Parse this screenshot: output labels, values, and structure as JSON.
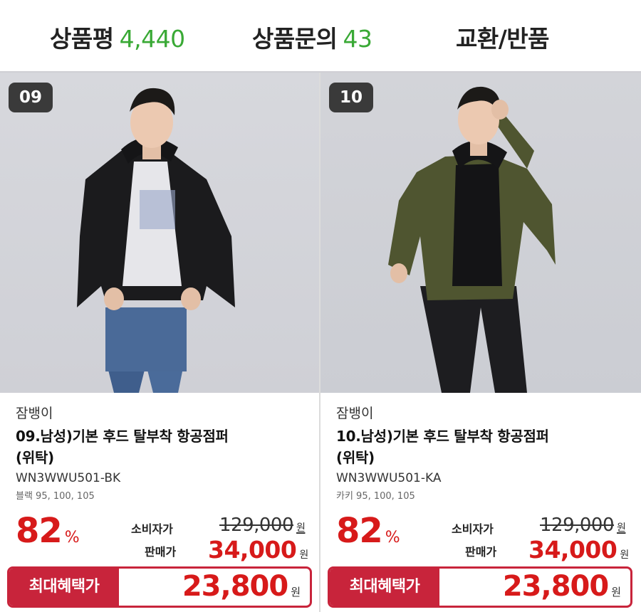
{
  "tabs": {
    "review": {
      "label": "상품평",
      "count": "4,440"
    },
    "qna": {
      "label": "상품문의",
      "count": "43"
    },
    "exchange": {
      "label": "교환/반품"
    }
  },
  "products": [
    {
      "badge": "09",
      "brand": "잠뱅이",
      "title_line1": "09.남성)기본 후드 탈부착 항공점퍼",
      "title_line2": "(위탁)",
      "sku": "WN3WWU501-BK",
      "options": "블랙 95, 100, 105",
      "discount": "82",
      "discount_unit": "%",
      "msrp_label": "소비자가",
      "msrp": "129,000",
      "sale_label": "판매가",
      "sale": "34,000",
      "currency": "원",
      "benefit_label": "최대혜택가",
      "benefit_price": "23,800",
      "jacket_color": "#1b1b1d"
    },
    {
      "badge": "10",
      "brand": "잠뱅이",
      "title_line1": "10.남성)기본 후드 탈부착 항공점퍼",
      "title_line2": "(위탁)",
      "sku": "WN3WWU501-KA",
      "options": "카키 95, 100, 105",
      "discount": "82",
      "discount_unit": "%",
      "msrp_label": "소비자가",
      "msrp": "129,000",
      "sale_label": "판매가",
      "sale": "34,000",
      "currency": "원",
      "benefit_label": "최대혜택가",
      "benefit_price": "23,800",
      "jacket_color": "#4f5530"
    }
  ],
  "colors": {
    "accent_red": "#d71a1a",
    "benefit_border": "#c8243b",
    "count_green": "#39a935"
  }
}
